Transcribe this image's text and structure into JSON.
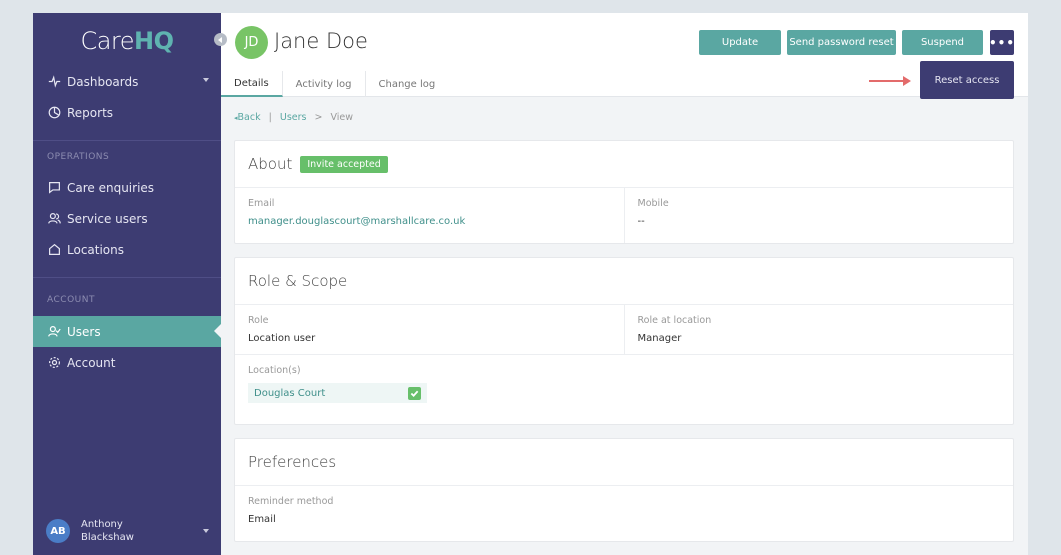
{
  "brand": {
    "part1": "Care",
    "part2": "HQ"
  },
  "sidebar": {
    "main": [
      {
        "label": "Dashboards",
        "icon": "activity-icon"
      },
      {
        "label": "Reports",
        "icon": "pie-chart-icon"
      }
    ],
    "operations_label": "OPERATIONS",
    "operations": [
      {
        "label": "Care enquiries",
        "icon": "chat-icon"
      },
      {
        "label": "Service users",
        "icon": "people-icon"
      },
      {
        "label": "Locations",
        "icon": "home-icon"
      }
    ],
    "account_label": "ACCOUNT",
    "account": [
      {
        "label": "Users",
        "icon": "user-check-icon",
        "active": true
      },
      {
        "label": "Account",
        "icon": "gear-icon"
      }
    ],
    "user": {
      "initials": "AB",
      "first": "Anthony",
      "last": "Blackshaw"
    }
  },
  "header": {
    "initials": "JD",
    "title": "Jane Doe",
    "buttons": {
      "update": "Update",
      "reset_password": "Send password reset",
      "suspend": "Suspend",
      "more": "•••"
    },
    "dropdown_item": "Reset access",
    "tabs": [
      "Details",
      "Activity log",
      "Change log"
    ]
  },
  "breadcrumb": {
    "back": "Back",
    "sep1": "|",
    "users": "Users",
    "sep2": ">",
    "current": "View"
  },
  "about": {
    "title": "About",
    "badge": "Invite accepted",
    "email_label": "Email",
    "email": "manager.douglascourt@marshallcare.co.uk",
    "mobile_label": "Mobile",
    "mobile": "--"
  },
  "role": {
    "title": "Role & Scope",
    "role_label": "Role",
    "role": "Location user",
    "role_at_location_label": "Role at location",
    "role_at_location": "Manager",
    "locations_label": "Location(s)",
    "location": "Douglas Court"
  },
  "preferences": {
    "title": "Preferences",
    "reminder_label": "Reminder method",
    "reminder": "Email"
  },
  "colors": {
    "sidebar": "#3d3c72",
    "accent": "#5aa7a2",
    "badge": "#67bf6a",
    "annotation_arrow": "#e36b6b"
  }
}
